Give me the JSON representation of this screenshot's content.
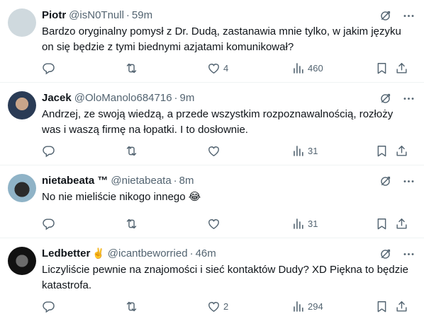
{
  "tweets": [
    {
      "name": "Piotr",
      "name_suffix": "",
      "handle": "@isN0Tnull",
      "time": "59m",
      "text": "Bardzo oryginalny pomysł z Dr. Dudą, zastanawia mnie tylko, w jakim języku on się będzie z tymi biednymi azjatami komunikował?",
      "likes": "4",
      "views": "460"
    },
    {
      "name": "Jacek",
      "name_suffix": "",
      "handle": "@OloManolo684716",
      "time": "9m",
      "text": "Andrzej, ze swoją wiedzą, a przede wszystkim rozpoznawalnością, rozłoży was i waszą firmę na łopatki. I to dosłownie.",
      "likes": "",
      "views": "31"
    },
    {
      "name": "nietabeata ™",
      "name_suffix": "",
      "handle": "@nietabeata",
      "time": "8m",
      "text": "No nie mieliście nikogo innego",
      "text_emoji": "😂",
      "likes": "",
      "views": "31"
    },
    {
      "name": "Ledbetter",
      "name_suffix": "✌️",
      "handle": "@icantbeworried",
      "time": "46m",
      "text": "Liczyliście pewnie na znajomości i sieć kontaktów Dudy? XD Piękna to będzie katastrofa.",
      "likes": "2",
      "views": "294"
    }
  ],
  "icons": {
    "grok": "grok-icon",
    "more": "more-icon",
    "reply": "reply-icon",
    "retweet": "retweet-icon",
    "like": "like-icon",
    "views": "views-icon",
    "bookmark": "bookmark-icon",
    "share": "share-icon"
  },
  "colors": {
    "text": "#0f1419",
    "secondary": "#536471",
    "divider": "#eff3f4"
  }
}
